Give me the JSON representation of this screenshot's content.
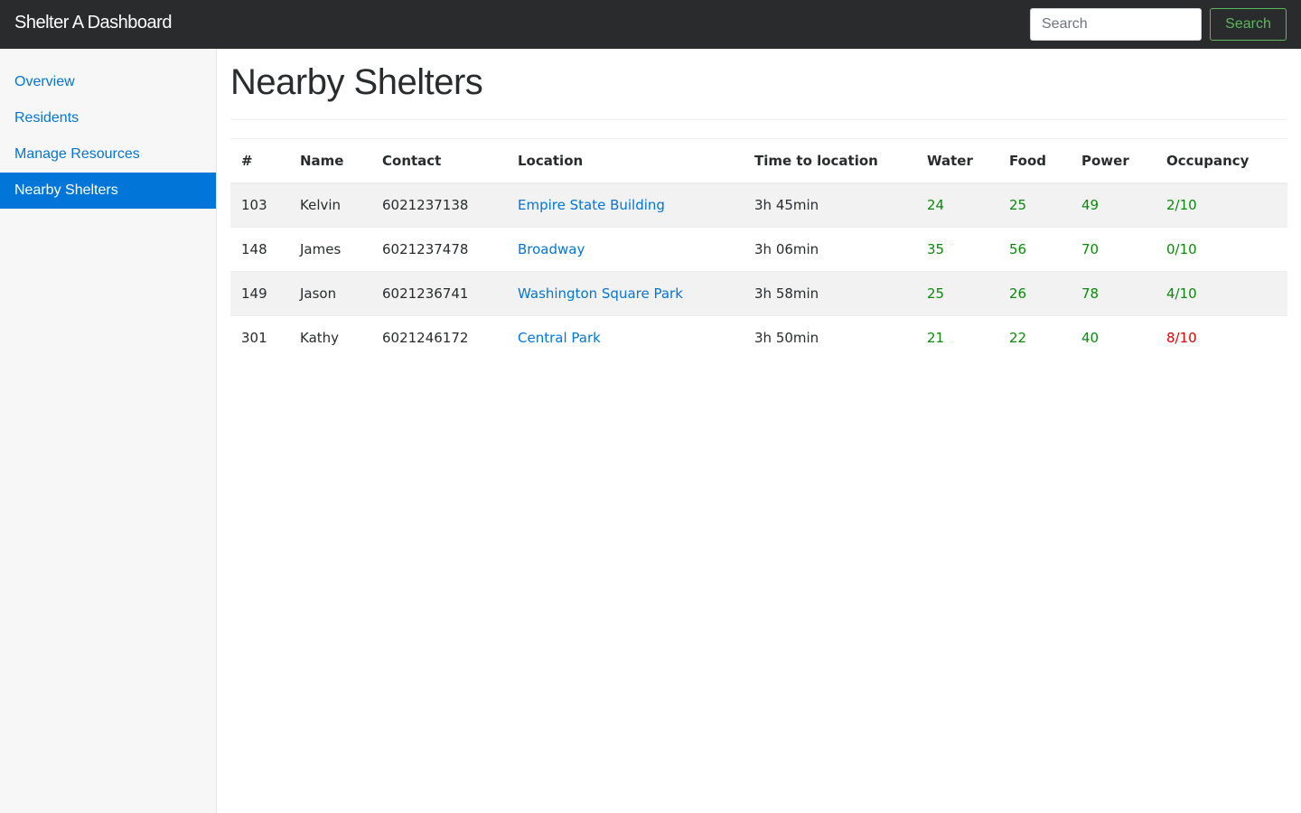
{
  "navbar": {
    "brand": "Shelter A Dashboard",
    "search_placeholder": "Search",
    "search_button": "Search"
  },
  "sidebar": {
    "items": [
      {
        "label": "Overview",
        "active": false
      },
      {
        "label": "Residents",
        "active": false
      },
      {
        "label": "Manage Resources",
        "active": false
      },
      {
        "label": "Nearby Shelters",
        "active": true
      }
    ]
  },
  "main": {
    "title": "Nearby Shelters",
    "table": {
      "headers": [
        "#",
        "Name",
        "Contact",
        "Location",
        "Time to location",
        "Water",
        "Food",
        "Power",
        "Occupancy"
      ],
      "rows": [
        {
          "id": "103",
          "name": "Kelvin",
          "contact": "6021237138",
          "location": "Empire State Building",
          "time": "3h 45min",
          "water": "24",
          "food": "25",
          "power": "49",
          "occupancy": "2/10",
          "occupancy_status": "ok"
        },
        {
          "id": "148",
          "name": "James",
          "contact": "6021237478",
          "location": "Broadway",
          "time": "3h 06min",
          "water": "35",
          "food": "56",
          "power": "70",
          "occupancy": "0/10",
          "occupancy_status": "ok"
        },
        {
          "id": "149",
          "name": "Jason",
          "contact": "6021236741",
          "location": "Washington Square Park",
          "time": "3h 58min",
          "water": "25",
          "food": "26",
          "power": "78",
          "occupancy": "4/10",
          "occupancy_status": "ok"
        },
        {
          "id": "301",
          "name": "Kathy",
          "contact": "6021246172",
          "location": "Central Park",
          "time": "3h 50min",
          "water": "21",
          "food": "22",
          "power": "40",
          "occupancy": "8/10",
          "occupancy_status": "bad"
        }
      ]
    }
  },
  "colors": {
    "navbar_bg": "#292b2c",
    "accent": "#0275d8",
    "success": "#5cb85c",
    "value_ok": "#0a8a0a",
    "value_bad": "#e00000"
  }
}
